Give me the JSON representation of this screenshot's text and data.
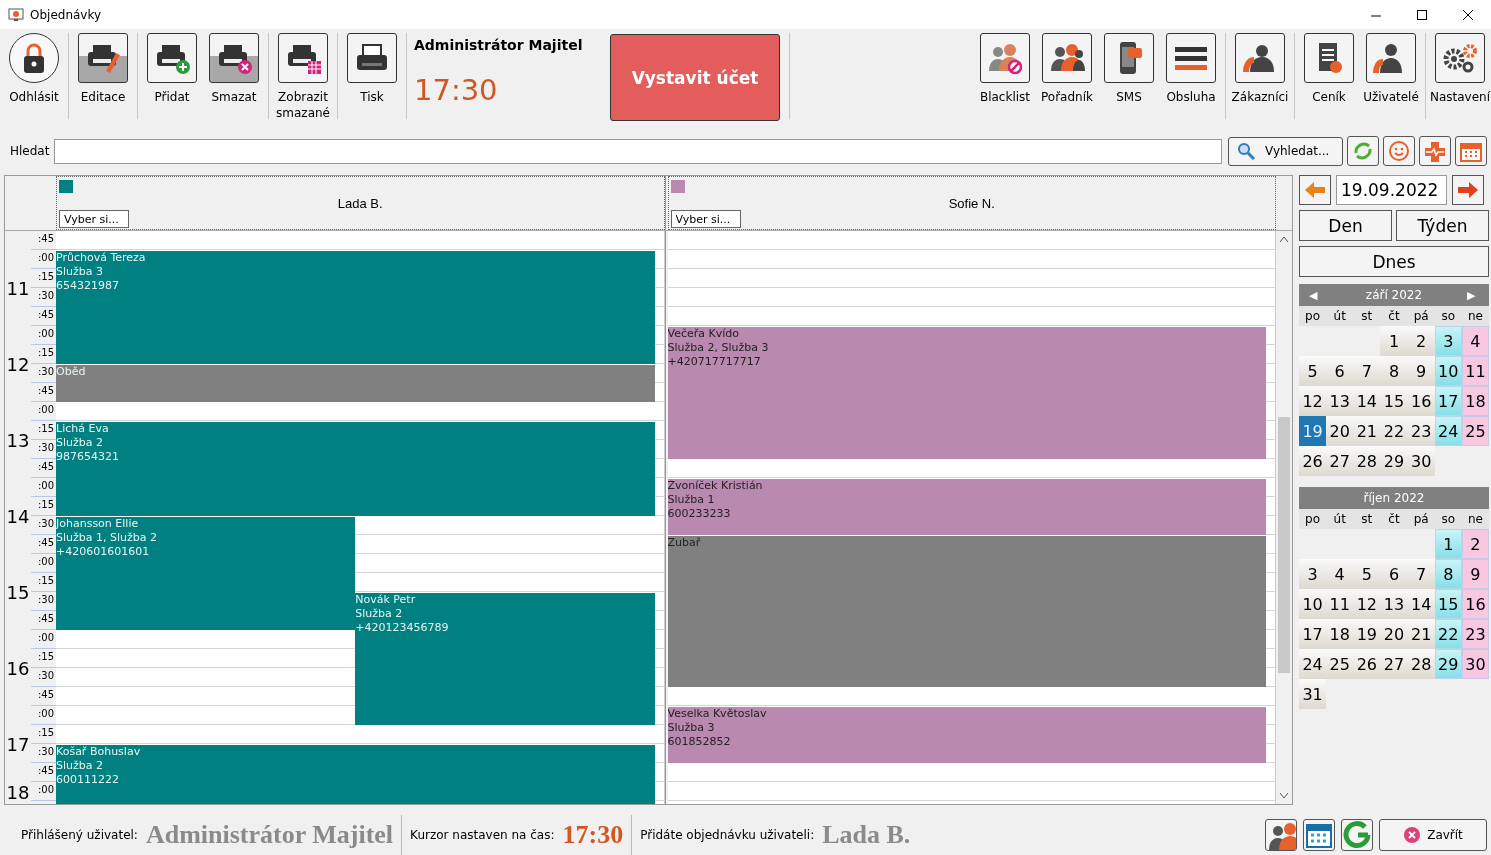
{
  "window": {
    "title": "Objednávky"
  },
  "toolbar": {
    "left_groups": [
      [
        {
          "label": "Odhlásit",
          "kind": "round",
          "disabled": false
        }
      ],
      [
        {
          "label": "Editace",
          "kind": "square",
          "disabled": true
        }
      ],
      [
        {
          "label": "Přidat",
          "kind": "square",
          "disabled": false
        },
        {
          "label": "Smazat",
          "kind": "square",
          "disabled": true
        }
      ],
      [
        {
          "label": "Zobrazit smazané",
          "kind": "square",
          "disabled": false
        }
      ],
      [
        {
          "label": "Tisk",
          "kind": "square",
          "disabled": false
        }
      ]
    ],
    "user": "Administrátor Majitel",
    "time": "17:30",
    "invoice_button": "Vystavit účet",
    "right_groups": [
      [
        {
          "label": "Blacklist"
        },
        {
          "label": "Pořadník"
        },
        {
          "label": "SMS"
        },
        {
          "label": "Obsluha"
        }
      ],
      [
        {
          "label": "Zákazníci"
        }
      ],
      [
        {
          "label": "Ceník"
        },
        {
          "label": "Uživatelé"
        }
      ],
      [
        {
          "label": "Nastavení"
        }
      ]
    ]
  },
  "search": {
    "label": "Hledat",
    "button": "Vyhledat..."
  },
  "schedule": {
    "hours": [
      {
        "minutes": [
          ":45"
        ]
      },
      {
        "hour": "11",
        "minutes": [
          ":00",
          ":15",
          ":30",
          ":45"
        ]
      },
      {
        "hour": "12",
        "minutes": [
          ":00",
          ":15",
          ":30",
          ":45"
        ]
      },
      {
        "hour": "13",
        "minutes": [
          ":00",
          ":15",
          ":30",
          ":45"
        ]
      },
      {
        "hour": "14",
        "minutes": [
          ":00",
          ":15",
          ":30",
          ":45"
        ]
      },
      {
        "hour": "15",
        "minutes": [
          ":00",
          ":15",
          ":30",
          ":45"
        ]
      },
      {
        "hour": "16",
        "minutes": [
          ":00",
          ":15",
          ":30",
          ":45"
        ]
      },
      {
        "hour": "17",
        "minutes": [
          ":00",
          ":15",
          ":30",
          ":45"
        ]
      },
      {
        "hour": "18",
        "minutes": [
          ":00"
        ]
      }
    ],
    "columns": [
      {
        "name": "Lada B.",
        "color": "#008080",
        "picker_placeholder": "Vyber si...",
        "appointments": [
          {
            "kind": "appointment",
            "lines": [
              "Průchová Tereza",
              "Služba 3",
              "654321987"
            ]
          },
          {
            "kind": "break",
            "lines": [
              "Oběd"
            ]
          },
          {
            "kind": "appointment",
            "lines": [
              "Lichá Eva",
              "Služba 2",
              "987654321"
            ]
          },
          {
            "kind": "appointment",
            "lines": [
              "Johansson Ellie",
              "Služba 1, Služba 2",
              "+420601601601"
            ]
          },
          {
            "kind": "appointment",
            "lines": [
              "Novák Petr",
              "Služba 2",
              "+420123456789"
            ]
          },
          {
            "kind": "appointment",
            "lines": [
              "Košař Bohuslav",
              "Služba 2",
              "600111222"
            ]
          }
        ]
      },
      {
        "name": "Sofie N.",
        "color": "#b989b0",
        "picker_placeholder": "Vyber si...",
        "appointments": [
          {
            "kind": "appointment",
            "lines": [
              "Večeřa Kvído",
              "Služba 2, Služba 3",
              "+420717717717"
            ]
          },
          {
            "kind": "appointment",
            "lines": [
              "Zvoníček Kristián",
              "Služba 1",
              "600233233"
            ]
          },
          {
            "kind": "break",
            "lines": [
              "Zubař"
            ]
          },
          {
            "kind": "appointment",
            "lines": [
              "Veselka Květoslav",
              "Služba 3",
              "601852852"
            ]
          }
        ]
      }
    ]
  },
  "sidebar": {
    "date": "19.09.2022",
    "view_buttons": [
      {
        "label": "Den"
      },
      {
        "label": "Týden"
      }
    ],
    "today_button": "Dnes",
    "months": [
      {
        "title": "září 2022",
        "prev": "◀",
        "next": "▶",
        "weekdays": [
          "po",
          "út",
          "st",
          "čt",
          "pá",
          "so",
          "ne"
        ],
        "weeks": [
          [
            {
              "d": "1",
              "selected": false
            },
            {
              "d": "2",
              "selected": false
            },
            {
              "d": "3",
              "selected": false
            },
            {
              "d": "4",
              "selected": false
            }
          ],
          [
            {
              "d": "5",
              "selected": false
            },
            {
              "d": "6",
              "selected": false
            },
            {
              "d": "7",
              "selected": false
            },
            {
              "d": "8",
              "selected": false
            },
            {
              "d": "9",
              "selected": false
            },
            {
              "d": "10",
              "selected": false
            },
            {
              "d": "11",
              "selected": false
            }
          ],
          [
            {
              "d": "12",
              "selected": false
            },
            {
              "d": "13",
              "selected": false
            },
            {
              "d": "14",
              "selected": false
            },
            {
              "d": "15",
              "selected": false
            },
            {
              "d": "16",
              "selected": false
            },
            {
              "d": "17",
              "selected": false
            },
            {
              "d": "18",
              "selected": false
            }
          ],
          [
            {
              "d": "19",
              "selected": true
            },
            {
              "d": "20",
              "selected": false
            },
            {
              "d": "21",
              "selected": false
            },
            {
              "d": "22",
              "selected": false
            },
            {
              "d": "23",
              "selected": false
            },
            {
              "d": "24",
              "selected": false
            },
            {
              "d": "25",
              "selected": false
            }
          ],
          [
            {
              "d": "26",
              "selected": false
            },
            {
              "d": "27",
              "selected": false
            },
            {
              "d": "28",
              "selected": false
            },
            {
              "d": "29",
              "selected": false
            },
            {
              "d": "30",
              "selected": false
            }
          ]
        ]
      },
      {
        "title": "říjen 2022",
        "weekdays": [
          "po",
          "út",
          "st",
          "čt",
          "pá",
          "so",
          "ne"
        ],
        "weeks": [
          [
            {
              "d": "1",
              "selected": false
            },
            {
              "d": "2",
              "selected": false
            }
          ],
          [
            {
              "d": "3",
              "selected": false
            },
            {
              "d": "4",
              "selected": false
            },
            {
              "d": "5",
              "selected": false
            },
            {
              "d": "6",
              "selected": false
            },
            {
              "d": "7",
              "selected": false
            },
            {
              "d": "8",
              "selected": false
            },
            {
              "d": "9",
              "selected": false
            }
          ],
          [
            {
              "d": "10",
              "selected": false
            },
            {
              "d": "11",
              "selected": false
            },
            {
              "d": "12",
              "selected": false
            },
            {
              "d": "13",
              "selected": false
            },
            {
              "d": "14",
              "selected": false
            },
            {
              "d": "15",
              "selected": false
            },
            {
              "d": "16",
              "selected": false
            }
          ],
          [
            {
              "d": "17",
              "selected": false
            },
            {
              "d": "18",
              "selected": false
            },
            {
              "d": "19",
              "selected": false
            },
            {
              "d": "20",
              "selected": false
            },
            {
              "d": "21",
              "selected": false
            },
            {
              "d": "22",
              "selected": false
            },
            {
              "d": "23",
              "selected": false
            }
          ],
          [
            {
              "d": "24",
              "selected": false
            },
            {
              "d": "25",
              "selected": false
            },
            {
              "d": "26",
              "selected": false
            },
            {
              "d": "27",
              "selected": false
            },
            {
              "d": "28",
              "selected": false
            },
            {
              "d": "29",
              "selected": false
            },
            {
              "d": "30",
              "selected": false
            }
          ],
          [
            {
              "d": "31",
              "selected": false
            }
          ]
        ]
      }
    ]
  },
  "status_bar": {
    "items": [
      {
        "label": "Přihlášený uživatel:",
        "value": "Administrátor Majitel",
        "kind": "plain"
      },
      {
        "label": "Kurzor nastaven na čas:",
        "value": "17:30",
        "kind": "accent"
      },
      {
        "label": "Přidáte objednávku uživateli:",
        "value": "Lada B.",
        "kind": "plain"
      }
    ],
    "close_button": "Zavřít"
  }
}
